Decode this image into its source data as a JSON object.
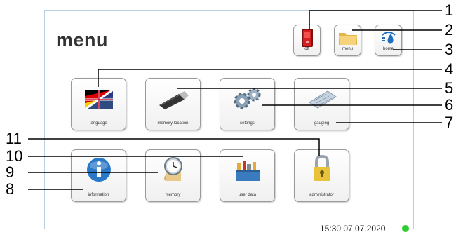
{
  "header": {
    "title": "menu"
  },
  "top_buttons": [
    {
      "label": "off"
    },
    {
      "label": "menu"
    },
    {
      "label": "home"
    }
  ],
  "tiles": [
    {
      "label": "language"
    },
    {
      "label": "memory location"
    },
    {
      "label": "settings"
    },
    {
      "label": "gauging"
    },
    {
      "label": "information"
    },
    {
      "label": "memory"
    },
    {
      "label": "user data"
    },
    {
      "label": "administrator"
    }
  ],
  "status": {
    "time": "15:30 07.07.2020",
    "indicator_color": "#2ecc2e"
  },
  "callouts": [
    "1",
    "2",
    "3",
    "4",
    "5",
    "6",
    "7",
    "8",
    "9",
    "10",
    "11"
  ]
}
